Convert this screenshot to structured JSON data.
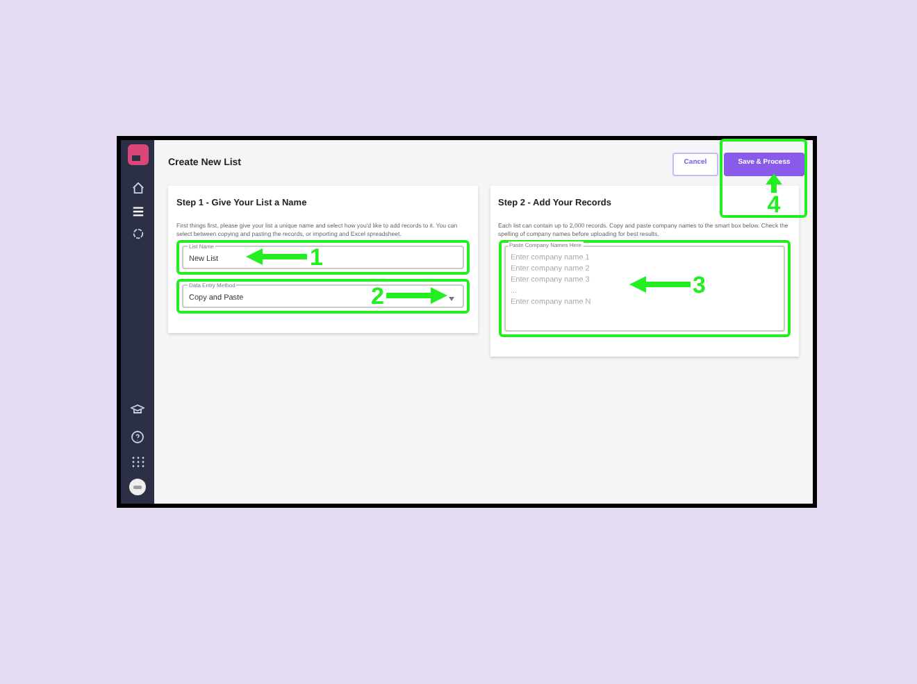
{
  "header": {
    "title": "Create New List"
  },
  "buttons": [
    {
      "label": "Cancel",
      "kind": "secondary"
    },
    {
      "label": "Save & Process",
      "kind": "primary"
    }
  ],
  "cards": [
    {
      "title": "Step 1 - Give Your List a Name",
      "description": "First things first, please give your list a unique name and select how you'd like to add records to it. You can select between copying and pasting the records, or importing and Excel spreadsheet.",
      "fields": [
        {
          "kind": "text",
          "label": "List Name",
          "value": "New List",
          "annotation": "1"
        },
        {
          "kind": "select",
          "label": "Data Entry Method",
          "value": "Copy and Paste",
          "annotation": "2"
        }
      ]
    },
    {
      "title": "Step 2 - Add Your Records",
      "description": "Each list can contain up to 2,000 records. Copy and paste company names to the smart box below. Check the spelling of company names before uploading for best results.",
      "fields": [
        {
          "kind": "textarea",
          "label": "Paste Company Names Here",
          "placeholder": "Enter company name 1\nEnter company name 2\nEnter company name 3\n...\nEnter company name N",
          "annotation": "3"
        }
      ]
    }
  ],
  "save_annotation": "4"
}
